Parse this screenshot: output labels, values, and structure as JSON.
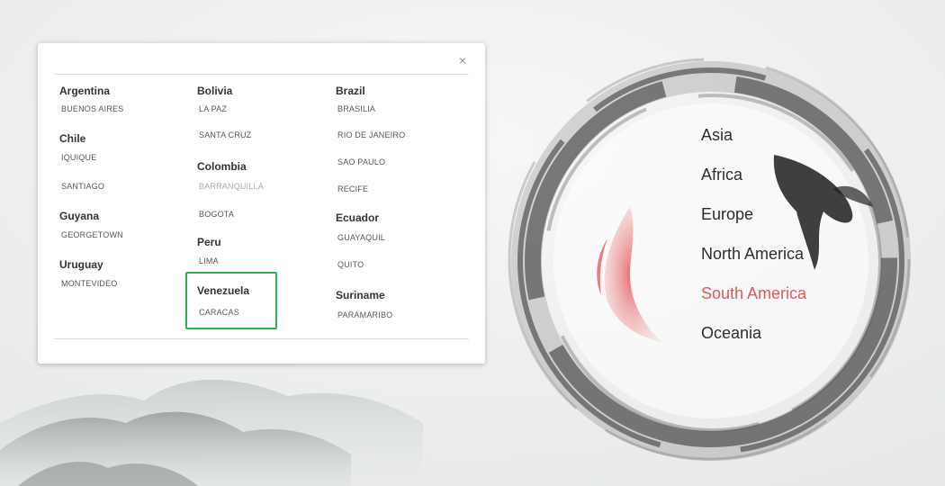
{
  "close_label": "×",
  "regions": {
    "col1": [
      {
        "country": "Argentina",
        "cities": [
          "BUENOS AIRES"
        ]
      },
      {
        "country": "Chile",
        "cities": [
          "IQUIQUE",
          "SANTIAGO"
        ]
      },
      {
        "country": "Guyana",
        "cities": [
          "GEORGETOWN"
        ]
      },
      {
        "country": "Uruguay",
        "cities": [
          "MONTEVIDEO"
        ]
      }
    ],
    "col2": [
      {
        "country": "Bolivia",
        "cities": [
          "LA PAZ",
          "SANTA CRUZ"
        ]
      },
      {
        "country": "Colombia",
        "cities": [
          "BARRANQUILLA",
          "BOGOTA"
        ]
      },
      {
        "country": "Peru",
        "cities": [
          "LIMA"
        ]
      },
      {
        "country": "Venezuela",
        "cities": [
          "CARACAS"
        ]
      }
    ],
    "col3": [
      {
        "country": "Brazil",
        "cities": [
          "BRASILIA",
          "RIO DE JANEIRO",
          "SAO PAULO",
          "RECIFE"
        ]
      },
      {
        "country": "Ecuador",
        "cities": [
          "GUAYAQUIL",
          "QUITO"
        ]
      },
      {
        "country": "Suriname",
        "cities": [
          "PARAMARIBO"
        ]
      }
    ]
  },
  "continents": [
    "Asia",
    "Africa",
    "Europe",
    "North America",
    "South America",
    "Oceania"
  ],
  "active_continent": "South America",
  "colors": {
    "accent": "#e0585a",
    "highlight": "#2fb14a"
  }
}
